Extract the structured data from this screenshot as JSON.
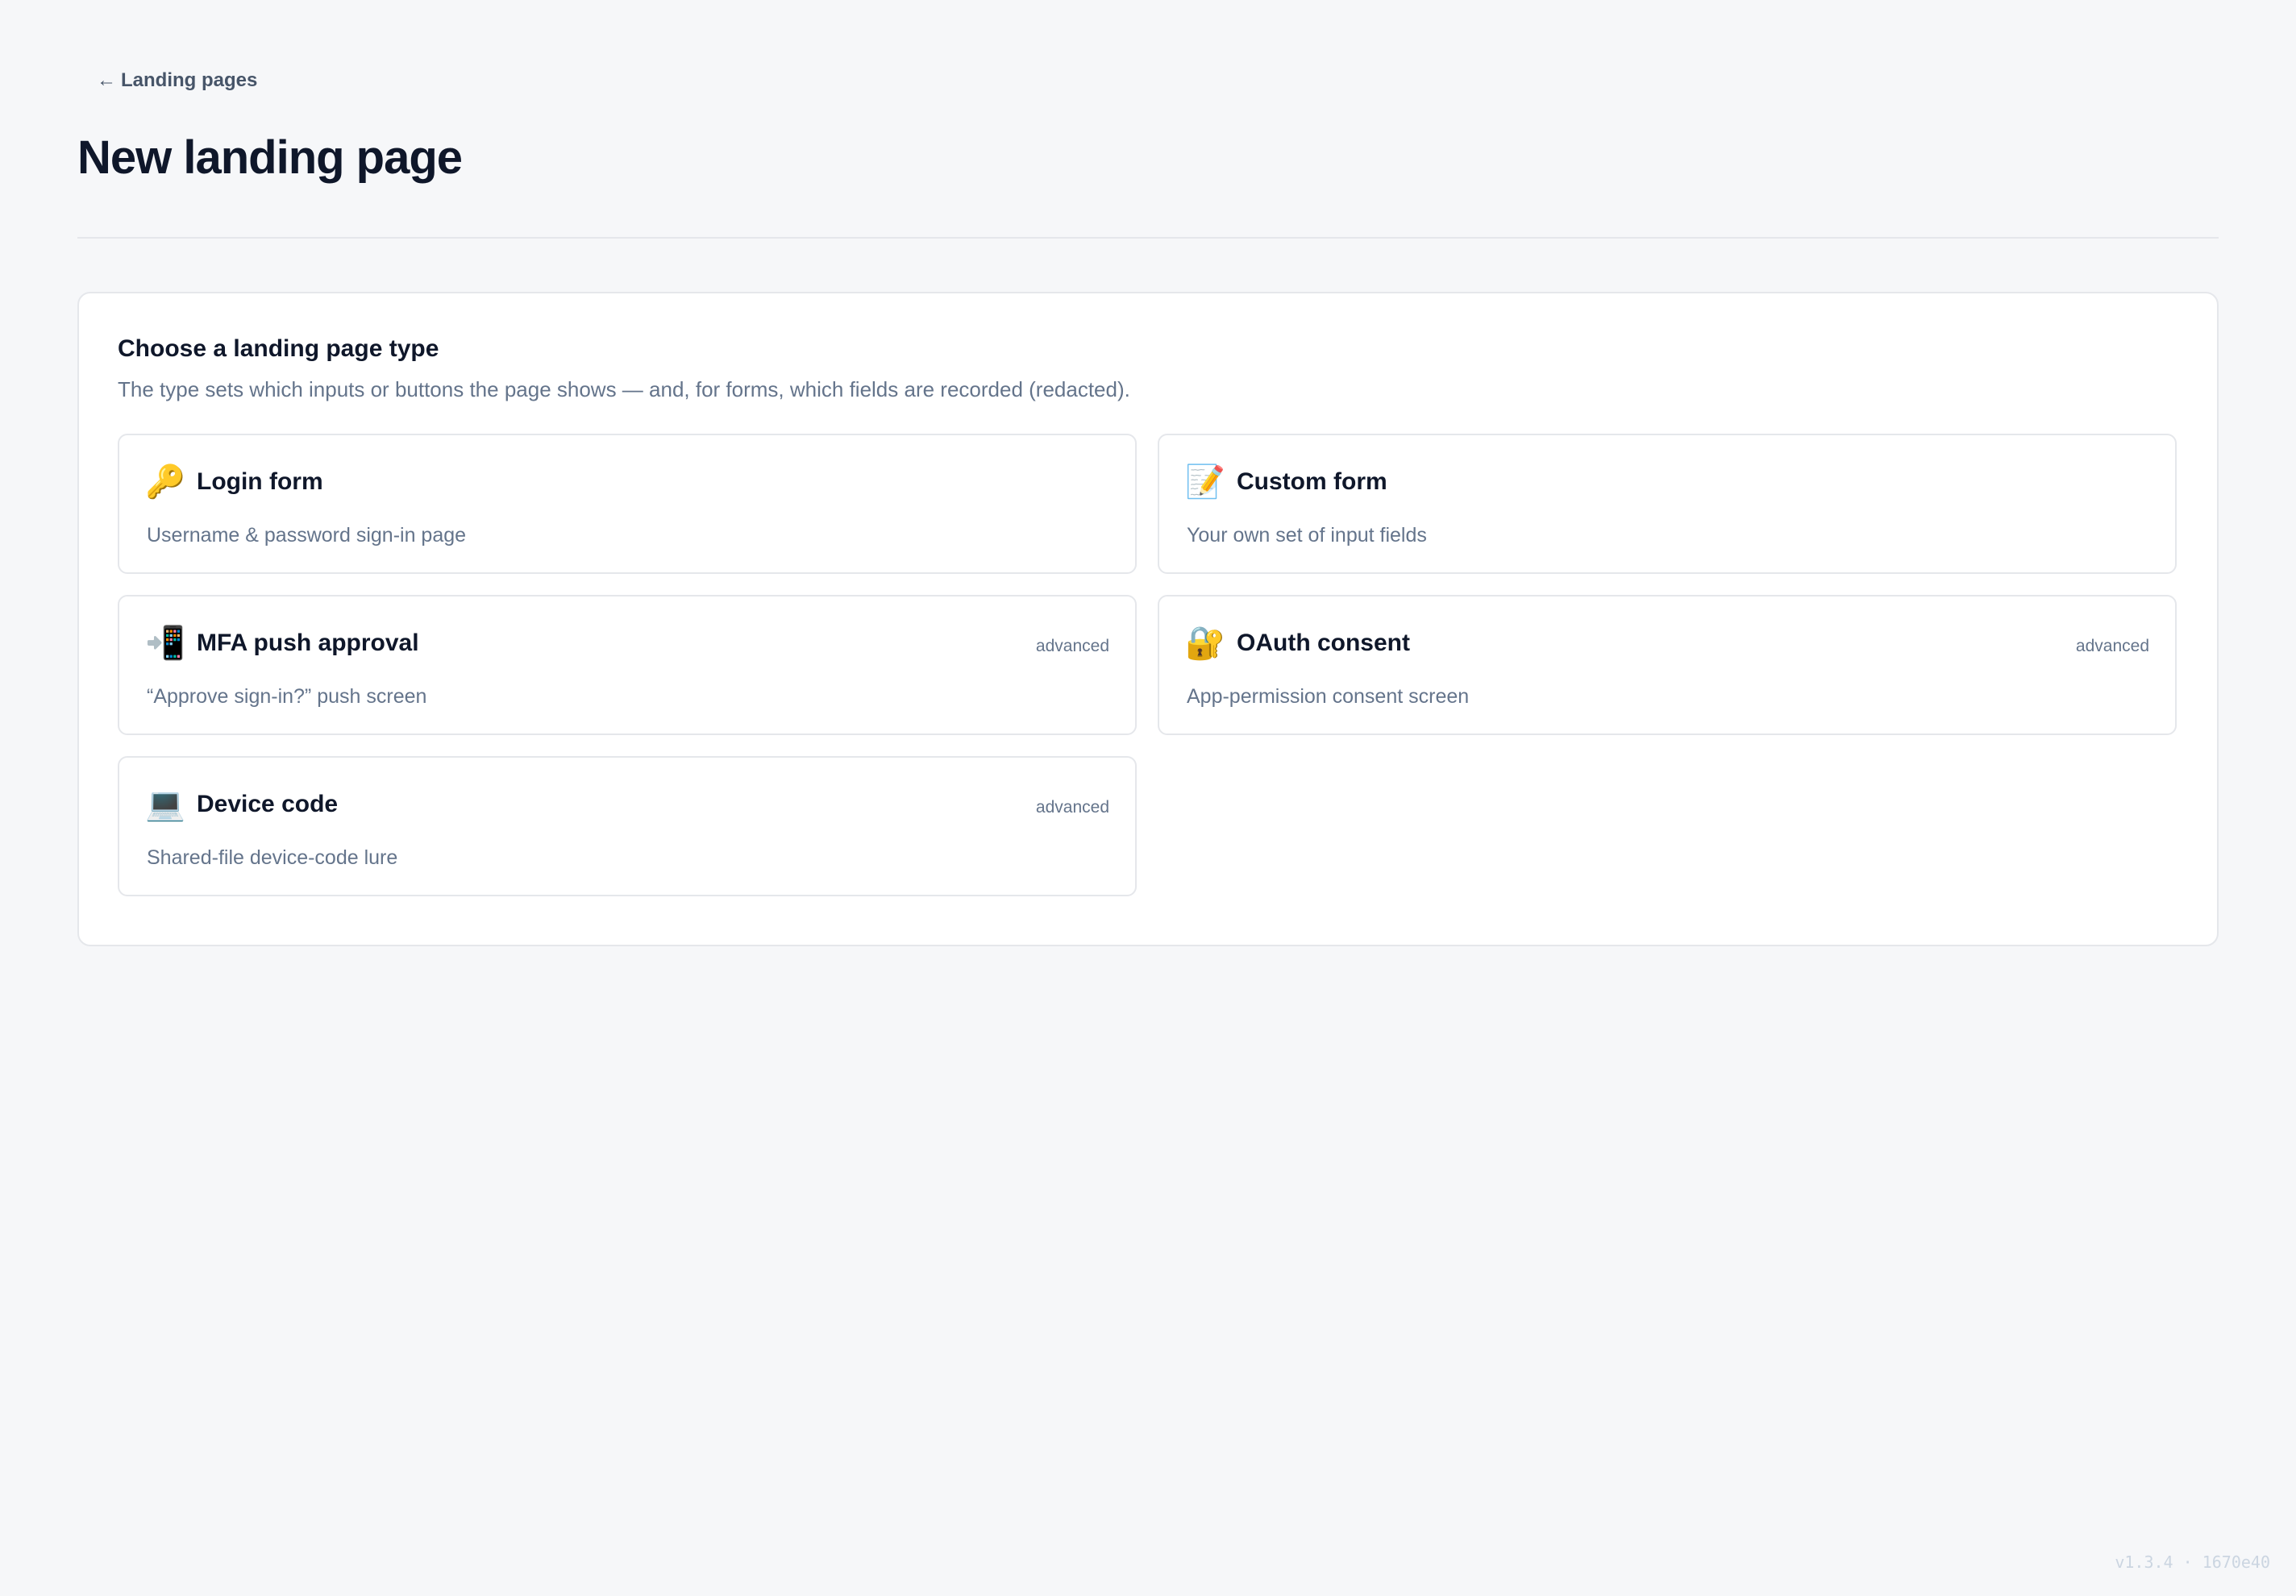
{
  "back_link": {
    "arrow": "←",
    "label": "Landing pages"
  },
  "page_title": "New landing page",
  "panel": {
    "title": "Choose a landing page type",
    "subtitle": "The type sets which inputs or buttons the page shows — and, for forms, which fields are recorded (redacted)."
  },
  "cards": [
    {
      "icon_name": "key-icon",
      "icon_glyph": "🔑",
      "title": "Login form",
      "description": "Username & password sign-in page",
      "badge": ""
    },
    {
      "icon_name": "memo-icon",
      "icon_glyph": "📝",
      "title": "Custom form",
      "description": "Your own set of input fields",
      "badge": ""
    },
    {
      "icon_name": "mobile-arrow-icon",
      "icon_glyph": "📲",
      "title": "MFA push approval",
      "description": "“Approve sign-in?” push screen",
      "badge": "advanced"
    },
    {
      "icon_name": "lock-key-icon",
      "icon_glyph": "🔐",
      "title": "OAuth consent",
      "description": "App-permission consent screen",
      "badge": "advanced"
    },
    {
      "icon_name": "laptop-icon",
      "icon_glyph": "💻",
      "title": "Device code",
      "description": "Shared-file device-code lure",
      "badge": "advanced"
    }
  ],
  "version": "v1.3.4 · 1670e40",
  "colors": {
    "background": "#f6f7f9",
    "panel": "#ffffff",
    "border": "#e5e7eb",
    "text": "#0f172a",
    "muted": "#64748b"
  }
}
